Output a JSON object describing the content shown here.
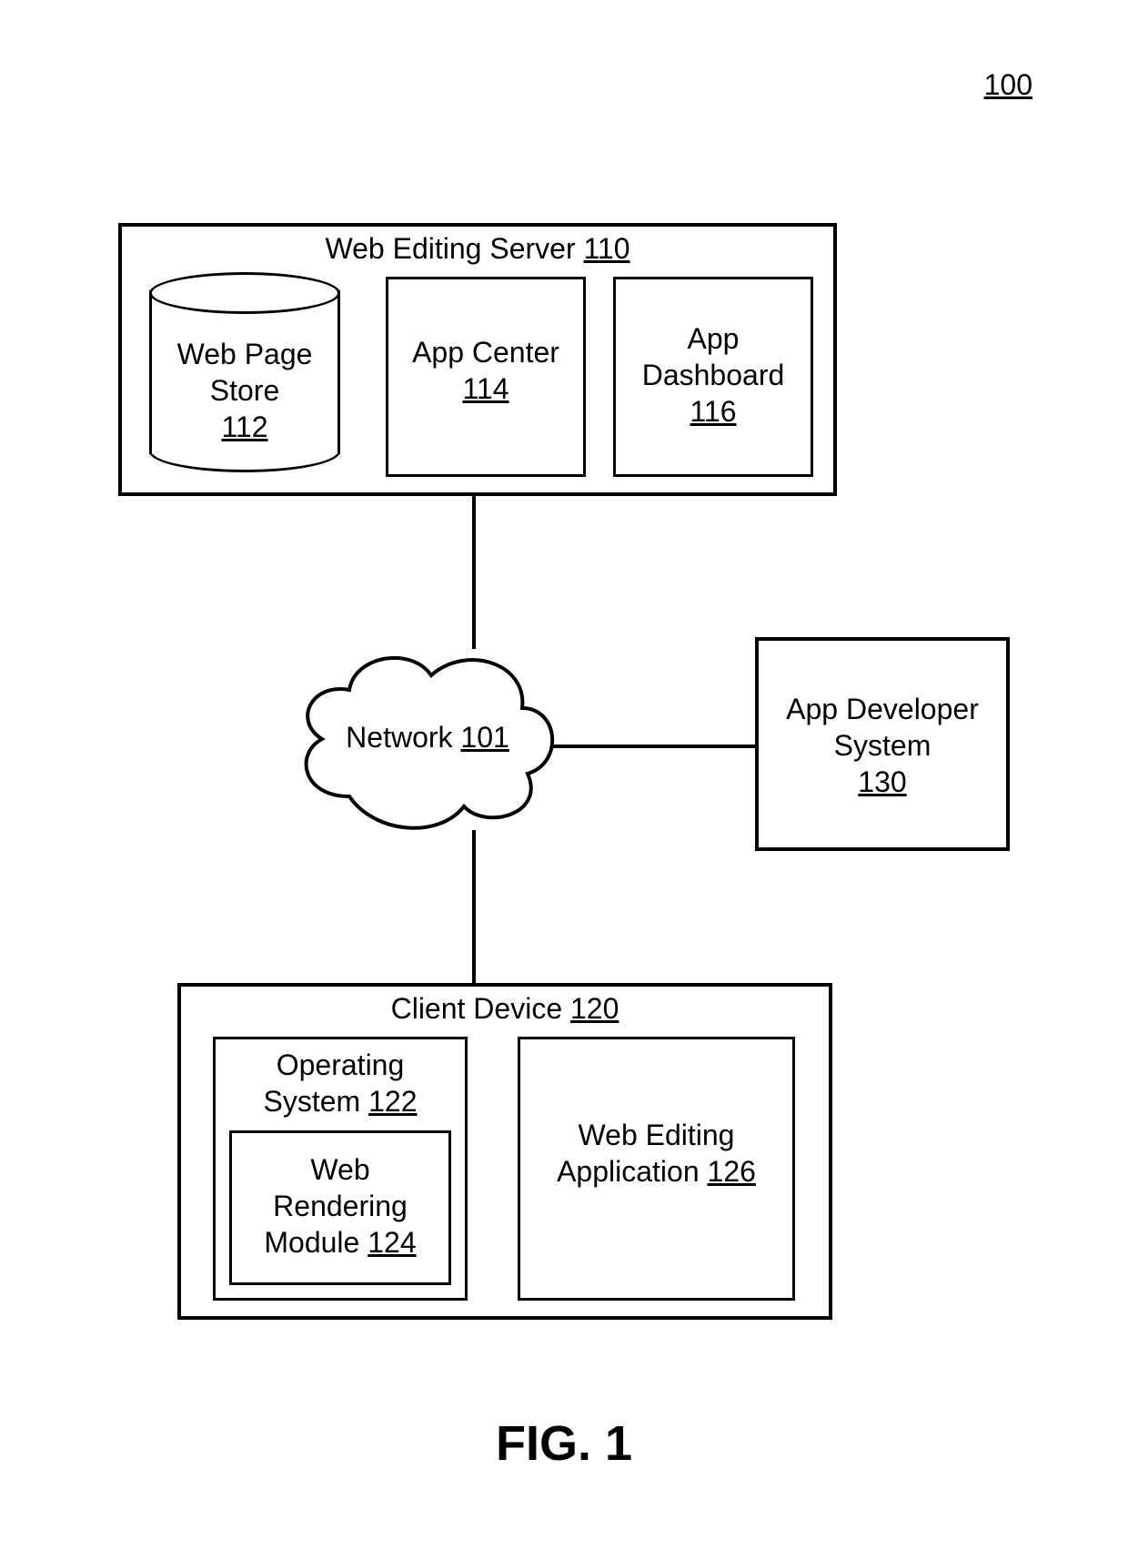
{
  "figure_ref": "100",
  "caption": "FIG. 1",
  "network": {
    "label": "Network",
    "ref": "101"
  },
  "server": {
    "title": "Web Editing Server",
    "ref": "110",
    "store": {
      "label_l1": "Web Page",
      "label_l2": "Store",
      "ref": "112"
    },
    "center": {
      "label": "App Center",
      "ref": "114"
    },
    "dashboard": {
      "label_l1": "App",
      "label_l2": "Dashboard",
      "ref": "116"
    }
  },
  "appdev": {
    "label_l1": "App Developer",
    "label_l2": "System",
    "ref": "130"
  },
  "client": {
    "title": "Client Device",
    "ref": "120",
    "os": {
      "label_l1": "Operating",
      "label_l2": "System",
      "ref": "122"
    },
    "render": {
      "label_l1": "Web",
      "label_l2": "Rendering",
      "label_l3": "Module",
      "ref": "124"
    },
    "editapp": {
      "label_l1": "Web Editing",
      "label_l2": "Application",
      "ref": "126"
    }
  }
}
